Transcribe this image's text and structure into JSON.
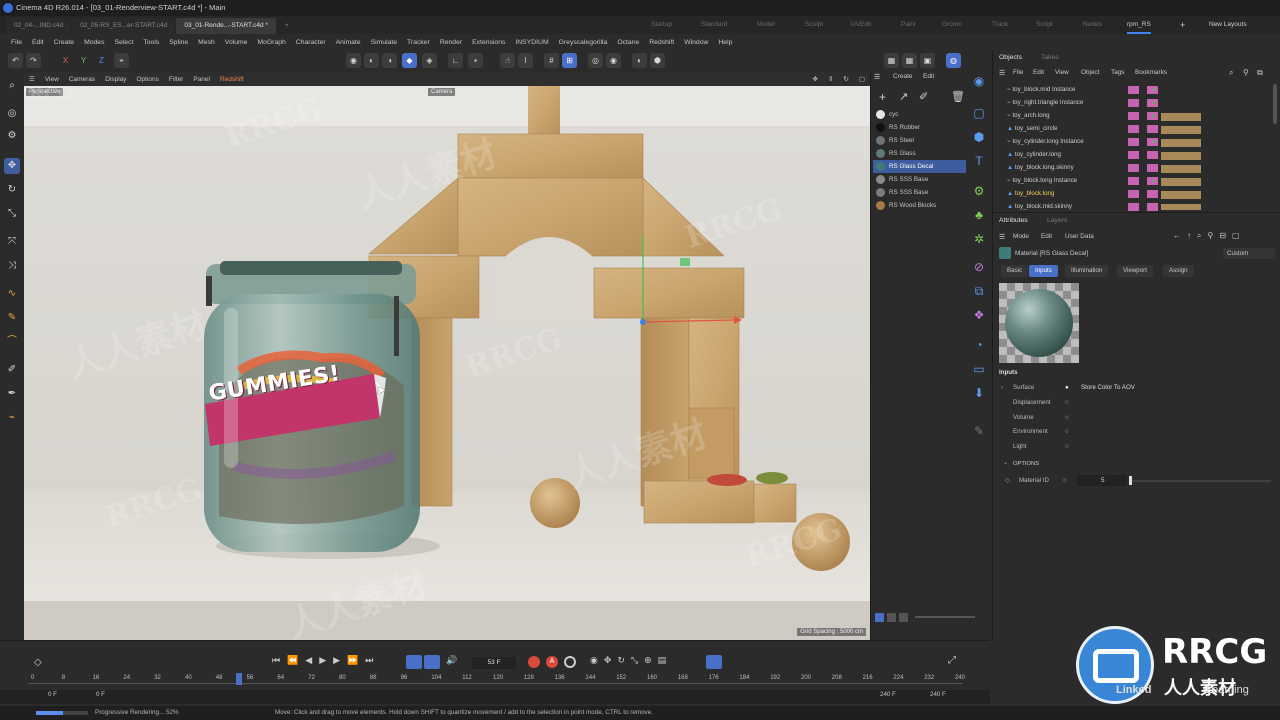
{
  "window": {
    "title": "Cinema 4D R26.014 - [03_01-Renderview-START.c4d *] - Main"
  },
  "file_tabs": [
    "02_04-...IND.c4d",
    "02_05-RS_ES...er-START.c4d",
    "03_01-Rende...-START.c4d *"
  ],
  "new_tab_icon": "+",
  "layout_tabs": [
    "Startup",
    "Standard",
    "Model",
    "Sculpt",
    "UVEdit",
    "Paint",
    "Groom",
    "Track",
    "Script",
    "Nodes",
    "rpm_RS"
  ],
  "new_layouts": "New Layouts",
  "menu": [
    "File",
    "Edit",
    "Create",
    "Modes",
    "Select",
    "Tools",
    "Spline",
    "Mesh",
    "Volume",
    "MoGraph",
    "Character",
    "Animate",
    "Simulate",
    "Tracker",
    "Render",
    "Extensions",
    "INSYDIUM",
    "Greyscalegorilla",
    "Octane",
    "Redshift",
    "Window",
    "Help"
  ],
  "toolbar": {
    "x": "X",
    "y": "Y",
    "z": "Z"
  },
  "viewport_menu": [
    "View",
    "Cameras",
    "Display",
    "Options",
    "Filter",
    "Panel",
    "Redshift"
  ],
  "viewport": {
    "mode": "Perspective",
    "camera": "Camera",
    "grid_spacing": "Grid Spacing : 5000 cm",
    "jar_label": "GUMMIES!"
  },
  "material_manager": {
    "menu": [
      "Create",
      "Edit"
    ],
    "materials": [
      {
        "name": "cyc",
        "color": "#e6e6e6"
      },
      {
        "name": "RS Rubber",
        "color": "#111111"
      },
      {
        "name": "RS Steel",
        "color": "#6f7478"
      },
      {
        "name": "RS Glass",
        "color": "#5f7a7a"
      },
      {
        "name": "RS Glass Decal",
        "color": "#3f7c78",
        "selected": true
      },
      {
        "name": "RS SSS Base",
        "color": "#8a8a8a"
      },
      {
        "name": "RS SSS Base",
        "color": "#7c7c7c"
      },
      {
        "name": "RS Wood Blocks",
        "color": "#a77a45"
      }
    ]
  },
  "objects_panel": {
    "tabs": [
      "Objects",
      "Takes"
    ],
    "menu": [
      "File",
      "Edit",
      "View",
      "Object",
      "Tags",
      "Bookmarks"
    ],
    "rows": [
      {
        "name": "toy_block.mid Instance",
        "highlight": false
      },
      {
        "name": "toy_right.triangle Instance",
        "highlight": false
      },
      {
        "name": "toy_arch.long",
        "highlight": false
      },
      {
        "name": "toy_semi_circle",
        "highlight": false
      },
      {
        "name": "toy_cylinder.long Instance",
        "highlight": false
      },
      {
        "name": "toy_cylinder.long",
        "highlight": false
      },
      {
        "name": "toy_block.long.skinny",
        "highlight": false
      },
      {
        "name": "toy_block.long Instance",
        "highlight": false
      },
      {
        "name": "toy_block.long",
        "highlight": true
      },
      {
        "name": "toy_block.mid.skinny",
        "highlight": false
      }
    ]
  },
  "attributes": {
    "tabs": [
      "Attributes",
      "Layers"
    ],
    "menu": [
      "Mode",
      "Edit",
      "User Data"
    ],
    "title": "Material [RS Glass Decal]",
    "preset": "Custom",
    "sub_tabs": [
      "Basic",
      "Inputs",
      "Illumination",
      "Viewport",
      "Assign"
    ],
    "active_sub_tab": "Inputs",
    "inputs_heading": "Inputs",
    "inputs": [
      {
        "label": "Surface",
        "value": "Store Color To AOV"
      },
      {
        "label": "Displacement",
        "value": ""
      },
      {
        "label": "Volume",
        "value": ""
      },
      {
        "label": "Environment",
        "value": ""
      },
      {
        "label": "Light",
        "value": ""
      }
    ],
    "options_heading": "OPTIONS",
    "material_id_label": "Material ID",
    "material_id_value": "5"
  },
  "timeline": {
    "current_frame": "53 F",
    "ticks": [
      "0",
      "8",
      "16",
      "24",
      "32",
      "40",
      "48",
      "56",
      "64",
      "72",
      "80",
      "88",
      "96",
      "104",
      "112",
      "120",
      "128",
      "136",
      "144",
      "152",
      "160",
      "168",
      "176",
      "184",
      "192",
      "200",
      "208",
      "216",
      "224",
      "232",
      "240"
    ],
    "start": "0 F",
    "start2": "0 F",
    "end": "240 F",
    "end2": "240 F"
  },
  "status": {
    "progress_label": "Progressive Rendering... 52%",
    "progress": 0.52,
    "hint": "Move: Click and drag to move elements. Hold down SHIFT to quantize movement / add to the selection in point mode, CTRL to remove."
  },
  "watermark": {
    "text1": "RRCG",
    "text2": "人人素材",
    "brand_big": "RRCG",
    "brand_small": "人人素材",
    "linked": "Linked",
    "learning": "Learning"
  }
}
